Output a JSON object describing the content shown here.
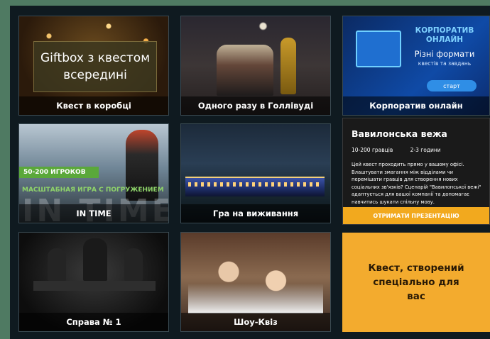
{
  "cards": {
    "gift": {
      "overlay_line1": "Giftbox з квестом",
      "overlay_line2": "всередині",
      "caption": "Квест в коробці"
    },
    "hollywood": {
      "caption": "Одного разу в Голлівуді"
    },
    "corporate": {
      "title_line1": "КОРПОРАТИВ",
      "title_line2": "ОНЛАЙН",
      "subtitle_line1": "Різні формати",
      "subtitle_line2": "квестів та завдань",
      "start_button": "старт",
      "caption": "Корпоратив онлайн"
    },
    "intime": {
      "badge": "50-200 ИГРОКОВ",
      "line": "МАСШТАБНАЯ ИГРА С ПОГРУЖЕНИЕМ",
      "big": "IN TIME",
      "caption": "IN TIME"
    },
    "survival": {
      "caption": "Гра на виживання"
    },
    "case": {
      "caption": "Справа № 1"
    },
    "quiz": {
      "caption": "Шоу-Квіз"
    }
  },
  "babylon": {
    "title": "Вавилонська вежа",
    "players": "10-200 гравців",
    "duration": "2-3 години",
    "description": "Цей квест проходить прямо у вашому офісі. Влаштувати змагання між відділами чи перемішати гравців для створення нових соціальних зв'язків? Сценарій \"Вавилонської вежі\" адаптується для вашої компанії та допомагає навчитись шукати спільну мову.",
    "button": "ОТРИМАТИ ПРЕЗЕНТАЦІЮ"
  },
  "custom": {
    "text_line1": "Квест, створений",
    "text_line2": "спеціально для вас"
  }
}
